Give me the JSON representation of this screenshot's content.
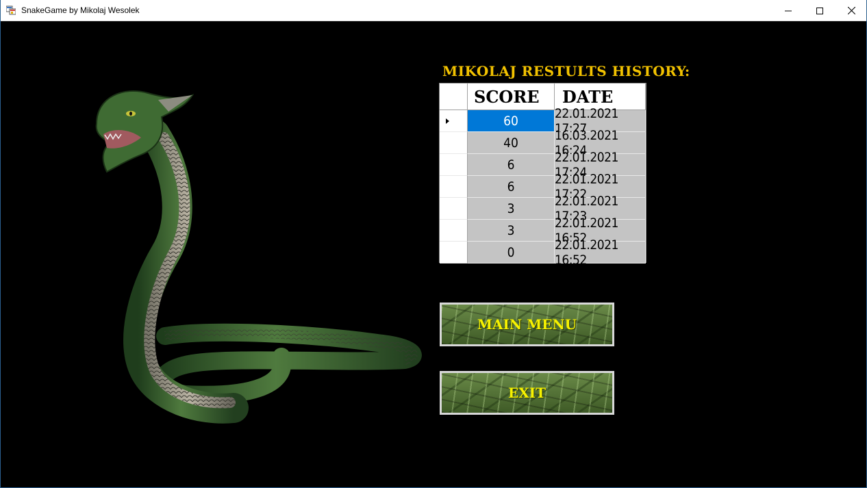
{
  "window": {
    "title": "SnakeGame by Mikolaj Wesolek",
    "minimize_glyph": "─",
    "maximize_glyph": "☐",
    "close_glyph": "✕"
  },
  "history": {
    "title": "MIKOLAJ RESTULTS HISTORY:",
    "columns": {
      "score": "SCORE",
      "date": "DATE"
    },
    "selected_row": 0,
    "rows": [
      {
        "score": "60",
        "date": "22.01.2021 17:27"
      },
      {
        "score": "40",
        "date": "16.03.2021 16:24"
      },
      {
        "score": "6",
        "date": "22.01.2021 17:24"
      },
      {
        "score": "6",
        "date": "22.01.2021 17:22"
      },
      {
        "score": "3",
        "date": "22.01.2021 17:23"
      },
      {
        "score": "3",
        "date": "22.01.2021 16:52"
      },
      {
        "score": "0",
        "date": "22.01.2021 16:52"
      }
    ]
  },
  "buttons": {
    "main_menu": "MAIN MENU",
    "exit": "EXIT"
  },
  "colors": {
    "title_yellow": "#f2c200",
    "button_text": "#f7f200",
    "selection_blue": "#0078d7",
    "cell_gray": "#c4c4c4"
  }
}
